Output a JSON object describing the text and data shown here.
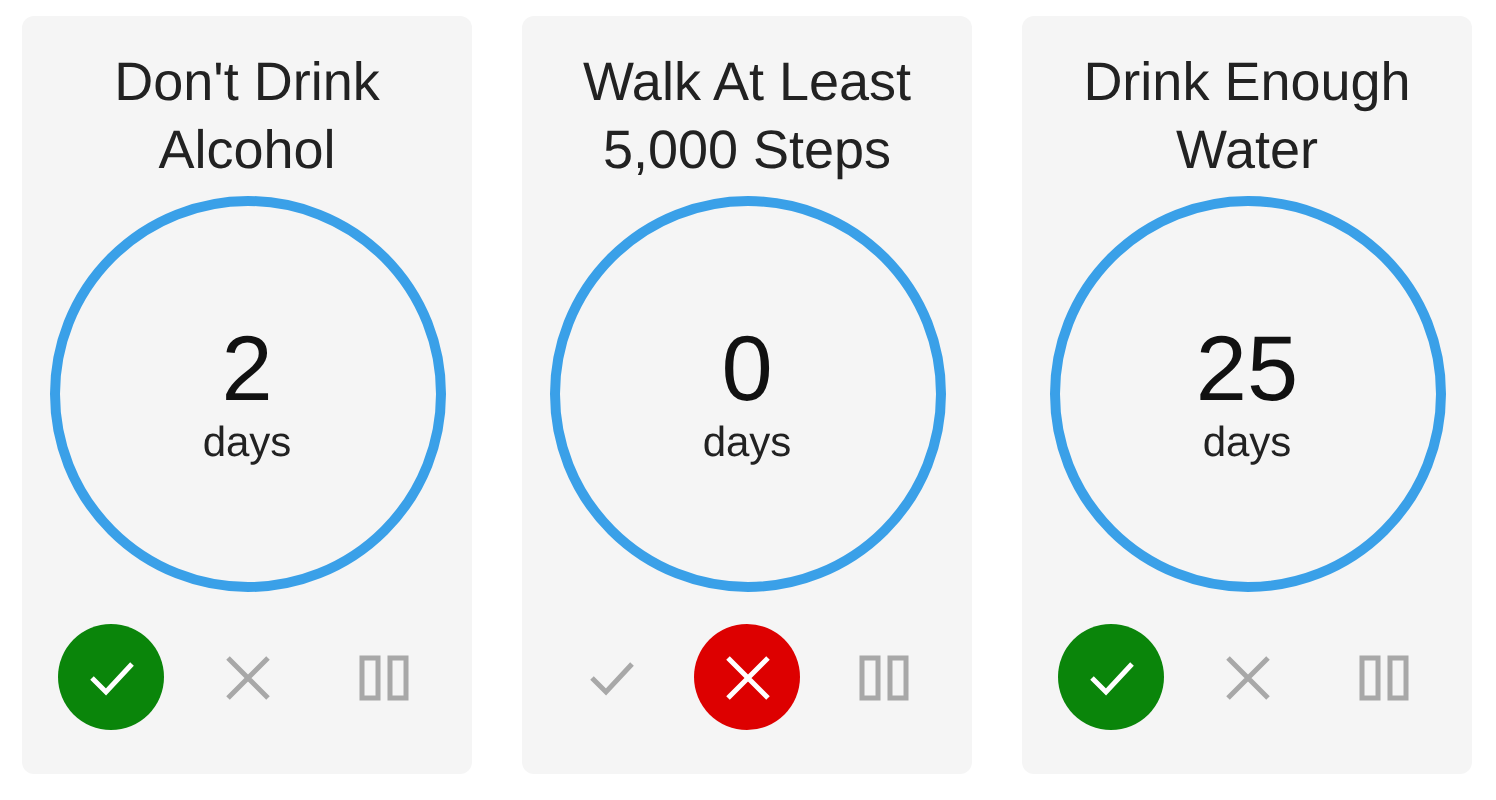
{
  "habits": [
    {
      "title": "Don't Drink Alcohol",
      "count": "2",
      "unit": "days",
      "actions": [
        {
          "kind": "check",
          "selected": true
        },
        {
          "kind": "cross",
          "selected": false
        },
        {
          "kind": "pause",
          "selected": false
        }
      ]
    },
    {
      "title": "Walk At Least 5,000 Steps",
      "count": "0",
      "unit": "days",
      "actions": [
        {
          "kind": "check",
          "selected": false
        },
        {
          "kind": "cross",
          "selected": true
        },
        {
          "kind": "pause",
          "selected": false
        }
      ]
    },
    {
      "title": "Drink Enough Water",
      "count": "25",
      "unit": "days",
      "actions": [
        {
          "kind": "check",
          "selected": true
        },
        {
          "kind": "cross",
          "selected": false
        },
        {
          "kind": "pause",
          "selected": false
        }
      ]
    }
  ]
}
